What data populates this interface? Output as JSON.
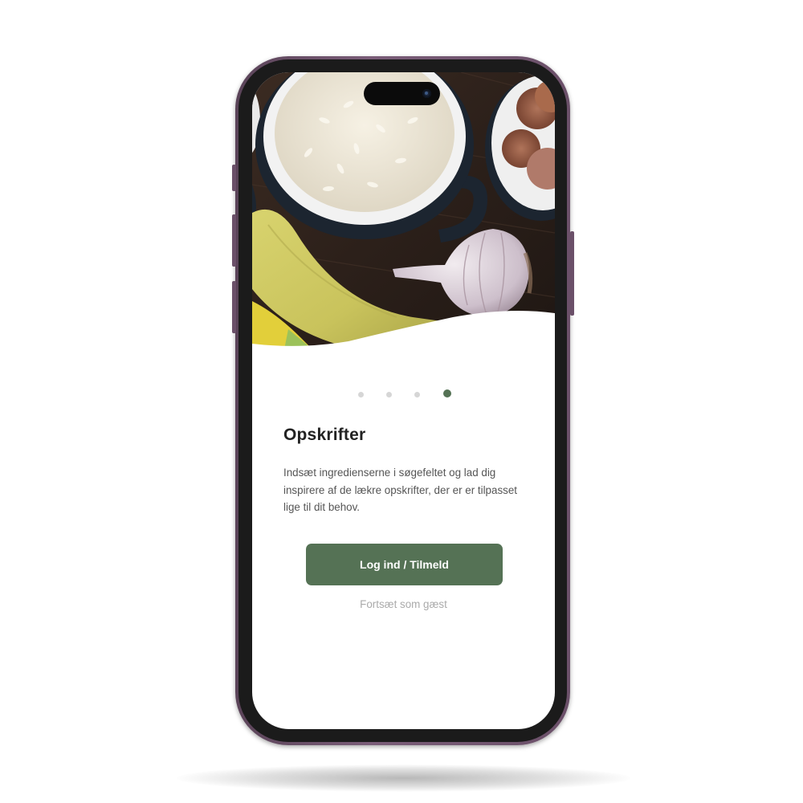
{
  "onboarding": {
    "page_indicator": {
      "total": 4,
      "current": 4
    },
    "title": "Opskrifter",
    "description": "Indsæt ingredienserne i søgefeltet og lad dig inspirere af de lækre opskrifter, der er er tilpasset lige til dit behov.",
    "login_button_label": "Log ind / Tilmeld",
    "guest_link_label": "Fortsæt som gæst"
  },
  "hero_image": {
    "subject": "food-ingredients-photo",
    "items": [
      "rice-bowl",
      "banana",
      "garlic",
      "salami-bowl"
    ]
  },
  "theme": {
    "accent": "#557255",
    "phone_frame": "#6b5069",
    "inactive_dot": "#d6d6d6"
  }
}
